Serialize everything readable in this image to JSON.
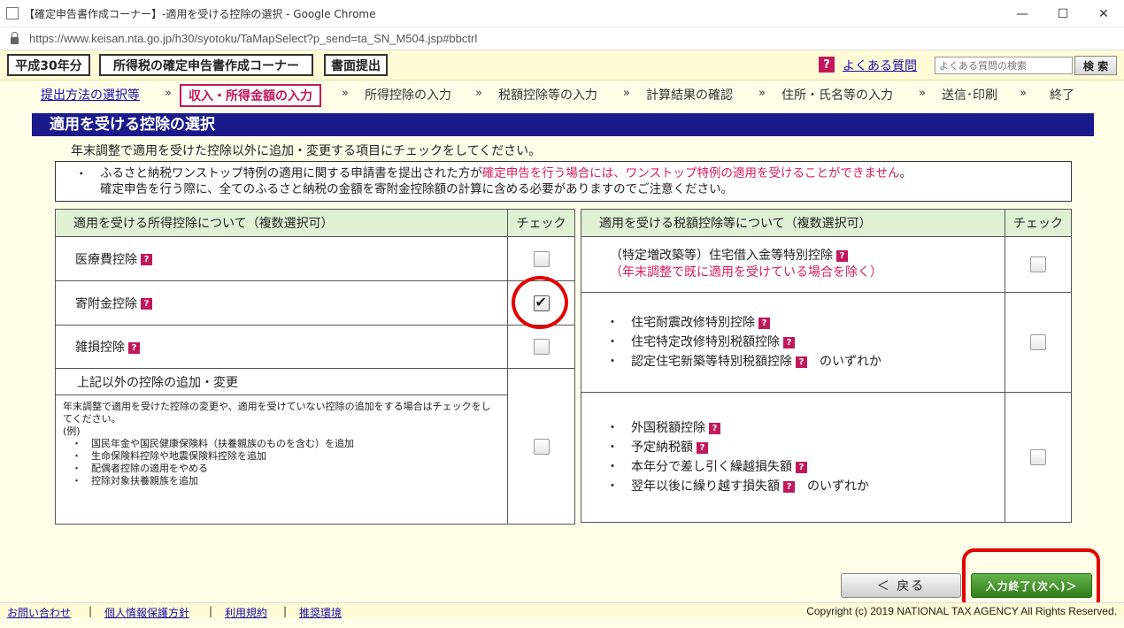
{
  "browser": {
    "title": "【確定申告書作成コーナー】-適用を受ける控除の選択 - Google Chrome",
    "url": "https://www.keisan.nta.go.jp/h30/syotoku/TaMapSelect?p_send=ta_SN_M504.jsp#bbctrl",
    "minimize": "—",
    "maximize": "☐",
    "close": "✕"
  },
  "header": {
    "year": "平成30年分",
    "corner": "所得税の確定申告書作成コーナー",
    "submission": "書面提出",
    "help_mark": "?",
    "faq_link": "よくある質問",
    "faq_placeholder": "よくある質問の検索",
    "search_button": "検 索"
  },
  "steps": [
    {
      "label": "提出方法の選択等"
    },
    {
      "label": "収入・所得金額の入力"
    },
    {
      "label": "所得控除の入力"
    },
    {
      "label": "税額控除等の入力"
    },
    {
      "label": "計算結果の確認"
    },
    {
      "label": "住所・氏名等の入力"
    },
    {
      "label": "送信･印刷"
    },
    {
      "label": "終了"
    }
  ],
  "step_separator": "»",
  "page": {
    "title": "適用を受ける控除の選択",
    "instruction": "年末調整で適用を受けた控除以外に追加・変更する項目にチェックをしてください。"
  },
  "notice": {
    "bullet": "・",
    "line1_a": "ふるさと納税ワンストップ特例の適用に関する申請書を提出された方が",
    "line1_b": "確定申告を行う場合には、ワンストップ特例の適用を受けることができません",
    "line1_c": "。",
    "line2": "確定申告を行う際に、全てのふるさと納税の金額を寄附金控除額の計算に含める必要がありますのでご注意ください。"
  },
  "income_table": {
    "header": "適用を受ける所得控除について（複数選択可）",
    "check_header": "チェック",
    "rows": [
      {
        "label": "医療費控除",
        "checked": false
      },
      {
        "label": "寄附金控除",
        "checked": true
      },
      {
        "label": "雑損控除",
        "checked": false
      }
    ],
    "other": {
      "label": "上記以外の控除の追加・変更",
      "desc": "年末調整で適用を受けた控除の変更や、適用を受けていない控除の追加をする場合はチェックをしてください。",
      "example_label": "(例)",
      "examples": [
        "国民年金や国民健康保険料（扶養親族のものを含む）を追加",
        "生命保険料控除や地震保険料控除を追加",
        "配偶者控除の適用をやめる",
        "控除対象扶養親族を追加"
      ],
      "checked": false
    }
  },
  "tax_table": {
    "header": "適用を受ける税額控除等について（複数選択可）",
    "check_header": "チェック",
    "row1": {
      "label": "（特定増改築等）住宅借入金等特別控除",
      "note": "（年末調整で既に適用を受けている場合を除く）",
      "checked": false
    },
    "row2": {
      "items": [
        "住宅耐震改修特別控除",
        "住宅特定改修特別税額控除",
        "認定住宅新築等特別税額控除"
      ],
      "suffix": "のいずれか",
      "checked": false
    },
    "row3": {
      "items": [
        "外国税額控除",
        "予定納税額",
        "本年分で差し引く繰越損失額",
        "翌年以後に繰り越す損失額"
      ],
      "suffix": "のいずれか",
      "checked": false
    }
  },
  "buttons": {
    "back": "＜ 戻る",
    "next": "入力終了(次へ)＞"
  },
  "footer": {
    "links": [
      "お問い合わせ",
      "個人情報保護方針",
      "利用規約",
      "推奨環境"
    ],
    "separator": "|",
    "copyright": "Copyright (c) 2019 NATIONAL TAX AGENCY All Rights Reserved."
  },
  "colors": {
    "title_bar": "#1a1a8c",
    "accent": "#c2185b",
    "next_button": "#2f7d1a",
    "highlight": "#e30000"
  }
}
